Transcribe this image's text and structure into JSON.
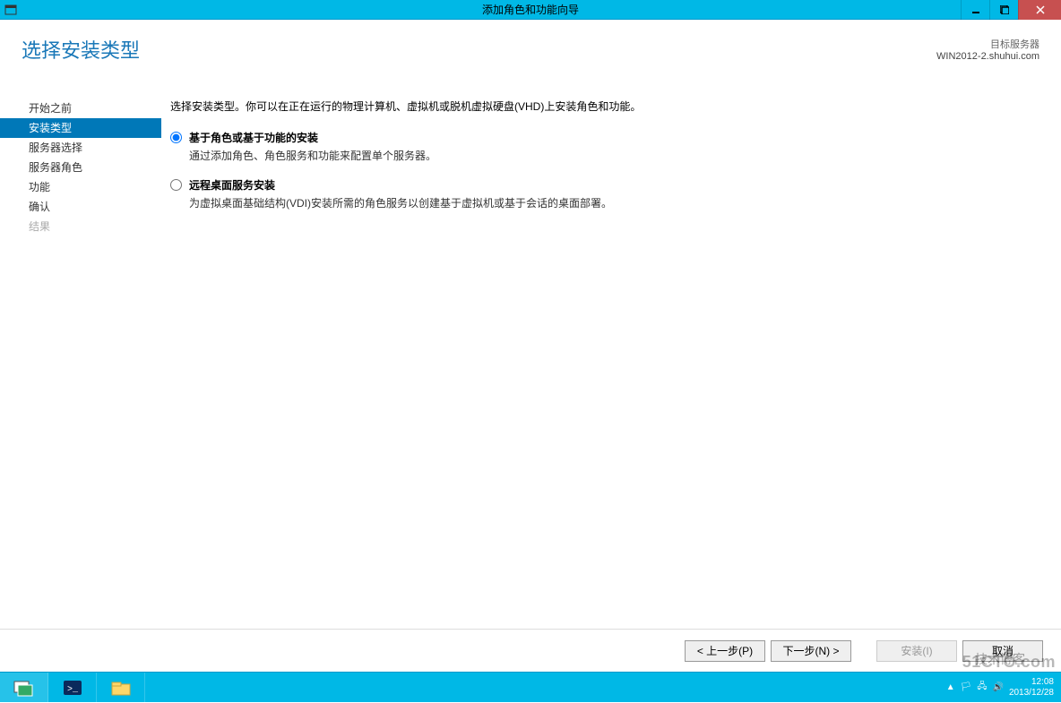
{
  "titlebar": {
    "title": "添加角色和功能向导"
  },
  "header": {
    "page_title": "选择安装类型",
    "target_label": "目标服务器",
    "target_name": "WIN2012-2.shuhui.com"
  },
  "sidebar": {
    "items": [
      {
        "label": "开始之前",
        "selected": false,
        "disabled": false
      },
      {
        "label": "安装类型",
        "selected": true,
        "disabled": false
      },
      {
        "label": "服务器选择",
        "selected": false,
        "disabled": false
      },
      {
        "label": "服务器角色",
        "selected": false,
        "disabled": false
      },
      {
        "label": "功能",
        "selected": false,
        "disabled": false
      },
      {
        "label": "确认",
        "selected": false,
        "disabled": false
      },
      {
        "label": "结果",
        "selected": false,
        "disabled": true
      }
    ]
  },
  "main": {
    "description": "选择安装类型。你可以在正在运行的物理计算机、虚拟机或脱机虚拟硬盘(VHD)上安装角色和功能。",
    "options": [
      {
        "title": "基于角色或基于功能的安装",
        "desc": "通过添加角色、角色服务和功能来配置单个服务器。",
        "checked": true
      },
      {
        "title": "远程桌面服务安装",
        "desc": "为虚拟桌面基础结构(VDI)安装所需的角色服务以创建基于虚拟机或基于会话的桌面部署。",
        "checked": false
      }
    ]
  },
  "footer": {
    "prev": "< 上一步(P)",
    "next": "下一步(N) >",
    "install": "安装(I)",
    "cancel": "取消"
  },
  "taskbar": {
    "time": "12:08",
    "date": "2013/12/28"
  },
  "watermark": {
    "site": "51CTO.com",
    "blog": "技术博客"
  }
}
